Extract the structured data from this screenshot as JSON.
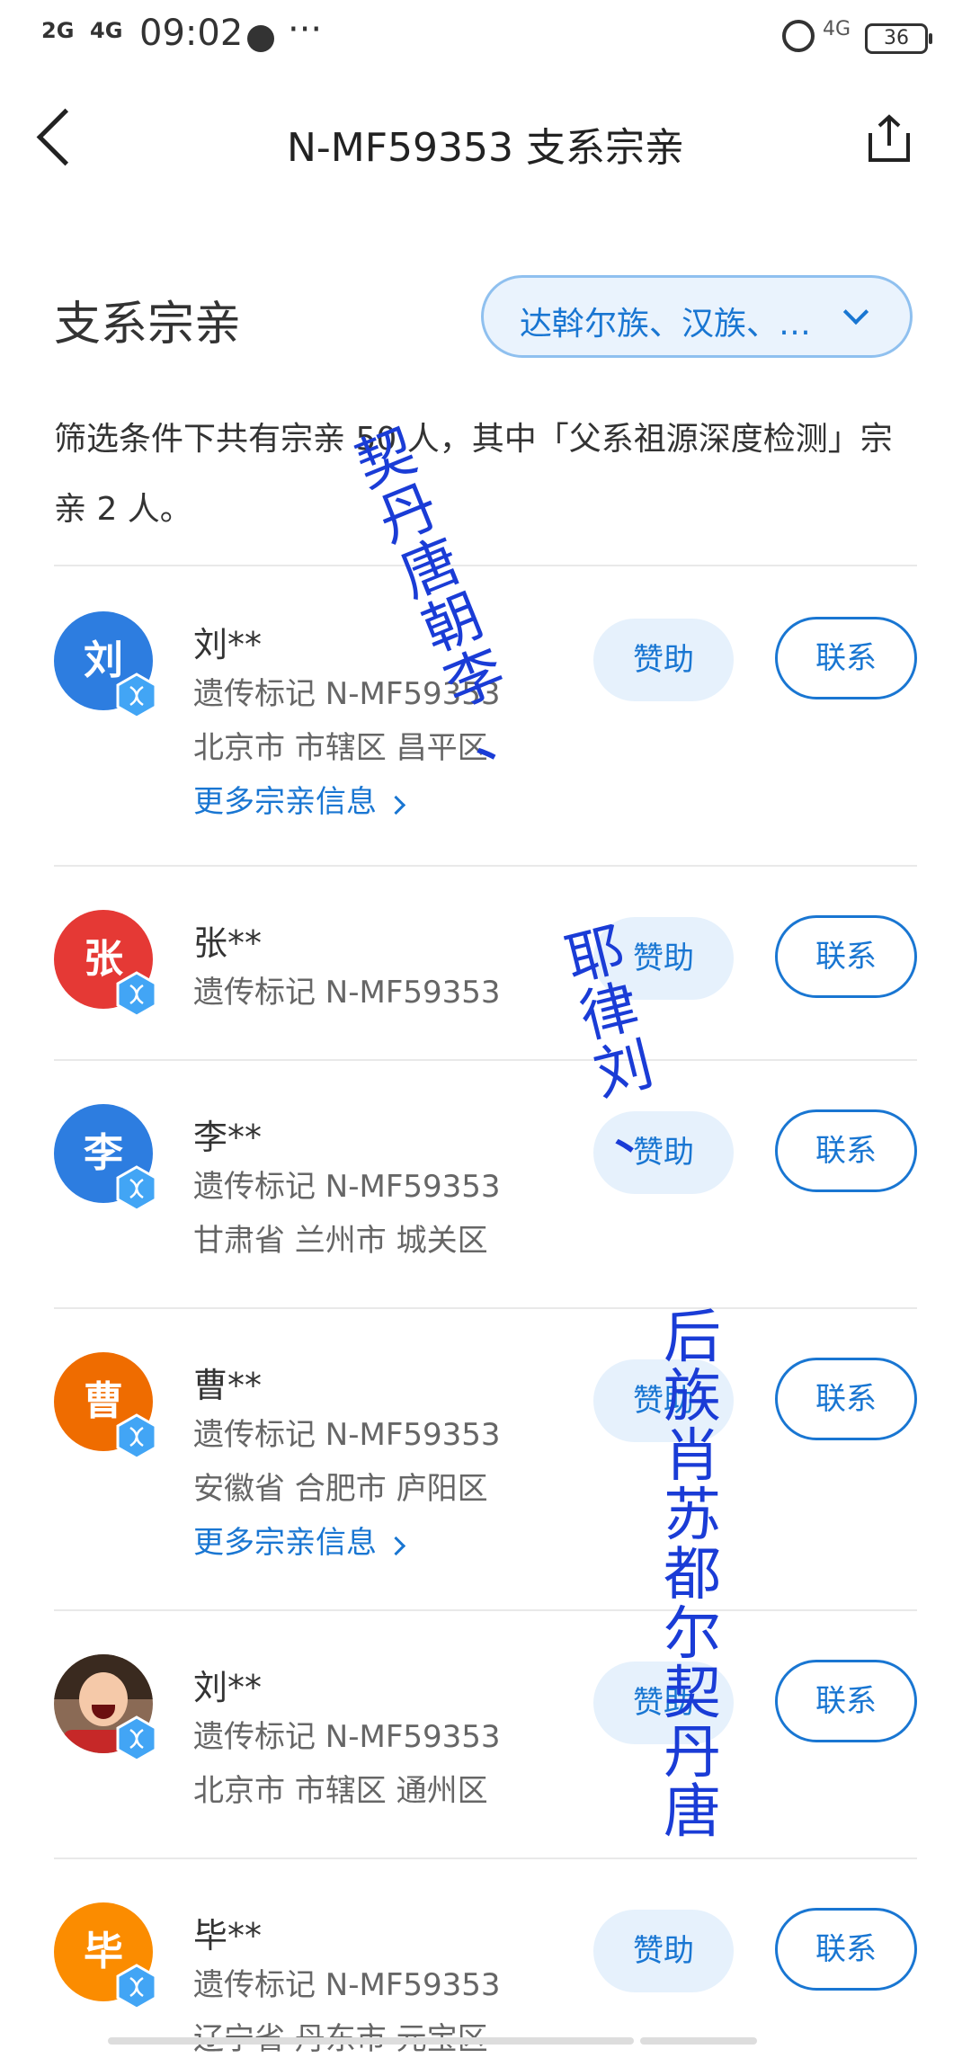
{
  "status_bar": {
    "signal_1": "2G",
    "signal_2": "4G",
    "time": "09:02",
    "network": "4G",
    "battery": "36"
  },
  "header": {
    "title": "N-MF59353 支系宗亲"
  },
  "section": {
    "title": "支系宗亲",
    "filter_label": "达斡尔族、汉族、…"
  },
  "summary": "筛选条件下共有宗亲 50 人，其中「父系祖源深度检测」宗亲 2 人。",
  "buttons": {
    "fund": "赞助",
    "contact": "联系"
  },
  "relatives": [
    {
      "avatar_char": "刘",
      "name": "刘**",
      "marker": "遗传标记 N-MF59353",
      "location": "北京市 市辖区 昌平区",
      "more": "更多宗亲信息",
      "avatar_color": "#2d7de0"
    },
    {
      "avatar_char": "张",
      "name": "张**",
      "marker": "遗传标记 N-MF59353",
      "avatar_color": "#e53935"
    },
    {
      "avatar_char": "李",
      "name": "李**",
      "marker": "遗传标记 N-MF59353",
      "location": "甘肃省 兰州市 城关区",
      "avatar_color": "#2d7de0"
    },
    {
      "avatar_char": "曹",
      "name": "曹**",
      "marker": "遗传标记 N-MF59353",
      "location": "安徽省 合肥市 庐阳区",
      "more": "更多宗亲信息",
      "avatar_color": "#ef6c00"
    },
    {
      "avatar_char": "",
      "name": "刘**",
      "marker": "遗传标记 N-MF59353",
      "location": "北京市 市辖区 通州区",
      "avatar_type": "photo"
    },
    {
      "avatar_char": "毕",
      "name": "毕**",
      "marker": "遗传标记 N-MF59353",
      "location": "辽宁省 丹东市 元宝区",
      "avatar_color": "#fb8c00"
    }
  ],
  "watermark": {
    "line1": "契丹唐朝李、",
    "line2": "耶律刘、",
    "line3": "后族肖苏都尔契丹唐"
  },
  "colors": {
    "accent": "#1976d2",
    "watermark": "#1a3cd6"
  }
}
